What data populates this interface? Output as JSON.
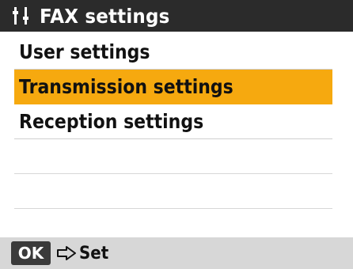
{
  "header": {
    "icon": "fax-settings-icon",
    "title": "FAX settings"
  },
  "menu": {
    "items": [
      {
        "label": "User settings",
        "selected": false
      },
      {
        "label": "Transmission settings",
        "selected": true
      },
      {
        "label": "Reception settings",
        "selected": false
      }
    ]
  },
  "footer": {
    "ok_key": "OK",
    "arrow_icon": "arrow-right-icon",
    "action_label": "Set"
  },
  "colors": {
    "title_bar": "#2b2b2b",
    "highlight": "#f6a90f",
    "footer_bar": "#d7d7d7"
  }
}
